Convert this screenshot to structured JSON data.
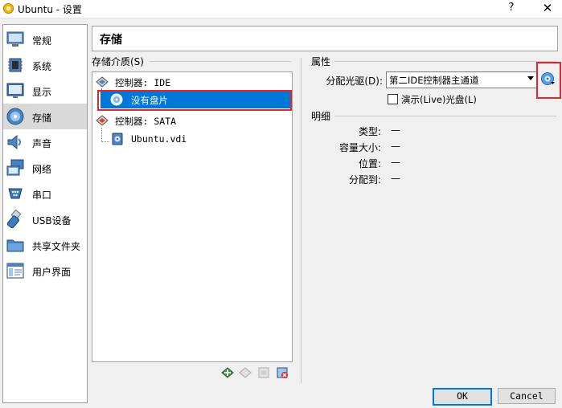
{
  "window": {
    "title": "Ubuntu - 设置",
    "help": "?",
    "close": "✕"
  },
  "sidebar": {
    "items": [
      {
        "label": "常规",
        "icon": "general-monitor-icon"
      },
      {
        "label": "系统",
        "icon": "system-chip-icon"
      },
      {
        "label": "显示",
        "icon": "display-monitor-icon"
      },
      {
        "label": "存储",
        "icon": "storage-disk-icon",
        "selected": true
      },
      {
        "label": "声音",
        "icon": "speaker-icon"
      },
      {
        "label": "网络",
        "icon": "network-icon"
      },
      {
        "label": "串口",
        "icon": "serial-port-icon"
      },
      {
        "label": "USB设备",
        "icon": "usb-icon"
      },
      {
        "label": "共享文件夹",
        "icon": "folder-icon"
      },
      {
        "label": "用户界面",
        "icon": "user-interface-icon"
      }
    ]
  },
  "page": {
    "title": "存储"
  },
  "storage": {
    "label": "存储介质(S)",
    "tree": {
      "ide_controller": "控制器: IDE",
      "empty_disc": "没有盘片",
      "sata_controller": "控制器: SATA",
      "vdi": "Ubuntu.vdi"
    }
  },
  "attributes": {
    "heading": "属性",
    "optical_drive_label": "分配光驱(D):",
    "optical_drive_value": "第二IDE控制器主通道",
    "live_cd_label": "演示(Live)光盘(L)",
    "live_cd_checked": false
  },
  "info": {
    "heading": "明细",
    "rows": [
      {
        "label": "类型:",
        "value": "—"
      },
      {
        "label": "容量大小:",
        "value": "—"
      },
      {
        "label": "位置:",
        "value": "—"
      },
      {
        "label": "分配到:",
        "value": "—"
      }
    ]
  },
  "buttons": {
    "ok": "OK",
    "cancel": "Cancel"
  },
  "colors": {
    "selection": "#0078d7",
    "highlight": "#e0262f"
  }
}
